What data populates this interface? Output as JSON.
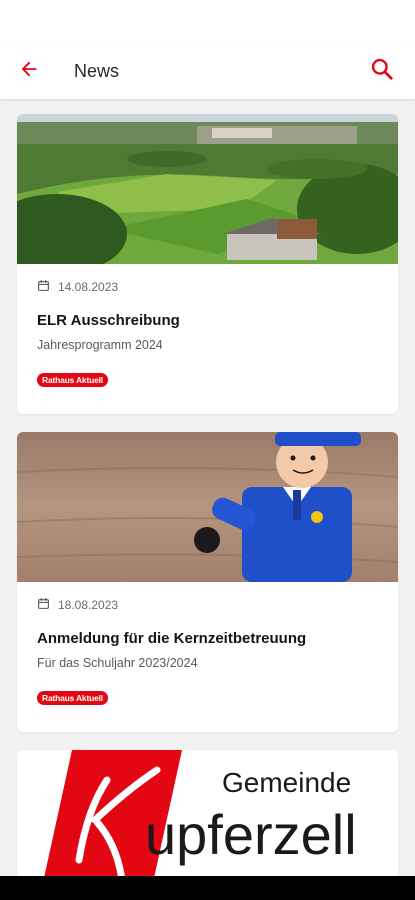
{
  "appbar": {
    "title": "News",
    "back_icon": "arrow-left-icon",
    "search_icon": "search-icon"
  },
  "colors": {
    "accent": "#e30613",
    "background": "#f2f2f2",
    "card": "#ffffff"
  },
  "news": [
    {
      "date": "14.08.2023",
      "title": "ELR Ausschreibung",
      "subtitle": "Jahresprogramm 2024",
      "category": "Rathaus Aktuell",
      "image": "aerial-village-landscape"
    },
    {
      "date": "18.08.2023",
      "title": "Anmeldung für die Kernzeitbetreuung",
      "subtitle": "Für das Schuljahr 2023/2024",
      "category": "Rathaus Aktuell",
      "image": "toy-figure-on-wooden-table"
    },
    {
      "image": "municipality-logo",
      "logo_text": {
        "line1": "Gemeinde",
        "line2": "upferzell",
        "letter": "K"
      }
    }
  ]
}
